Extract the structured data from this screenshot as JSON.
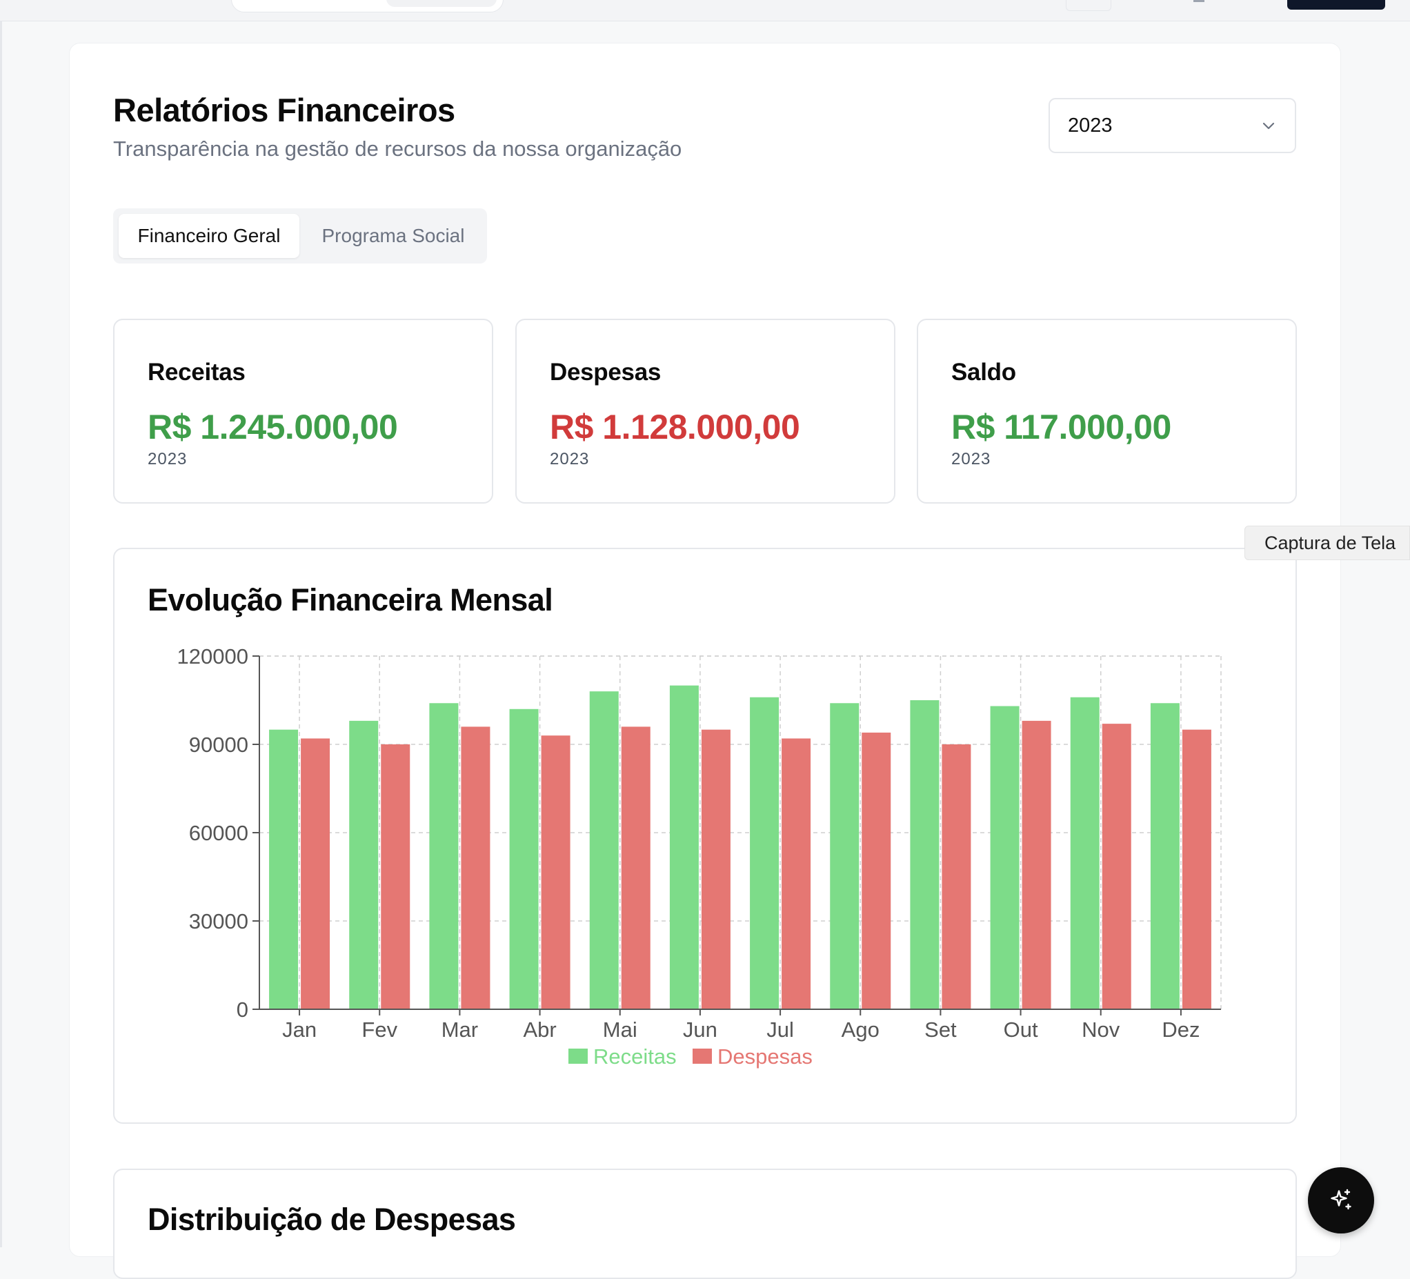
{
  "header": {
    "title": "Relatórios Financeiros",
    "subtitle": "Transparência na gestão de recursos da nossa organização"
  },
  "year_select": {
    "value": "2023",
    "icon": "chevron-down-icon"
  },
  "tabs": [
    {
      "label": "Financeiro Geral",
      "active": true
    },
    {
      "label": "Programa Social",
      "active": false
    }
  ],
  "stats": [
    {
      "label": "Receitas",
      "value": "R$ 1.245.000,00",
      "year": "2023",
      "color": "#3f9e4a"
    },
    {
      "label": "Despesas",
      "value": "R$ 1.128.000,00",
      "year": "2023",
      "color": "#d13b3b"
    },
    {
      "label": "Saldo",
      "value": "R$ 117.000,00",
      "year": "2023",
      "color": "#3f9e4a"
    }
  ],
  "tooltip": {
    "text": "Captura de Tela"
  },
  "chart": {
    "title": "Evolução Financeira Mensal"
  },
  "second_section": {
    "title": "Distribuição de Despesas"
  },
  "fab": {
    "icon": "sparkles-icon"
  },
  "colors": {
    "receitas": "#7ddc89",
    "despesas": "#e57773",
    "accent_green": "#3f9e4a",
    "accent_red": "#d13b3b"
  },
  "chart_data": {
    "type": "bar",
    "title": "Evolução Financeira Mensal",
    "xlabel": "",
    "ylabel": "",
    "categories": [
      "Jan",
      "Fev",
      "Mar",
      "Abr",
      "Mai",
      "Jun",
      "Jul",
      "Ago",
      "Set",
      "Out",
      "Nov",
      "Dez"
    ],
    "series": [
      {
        "name": "Receitas",
        "color": "#7ddc89",
        "values": [
          95000,
          98000,
          104000,
          102000,
          108000,
          110000,
          106000,
          104000,
          105000,
          103000,
          106000,
          104000
        ]
      },
      {
        "name": "Despesas",
        "color": "#e57773",
        "values": [
          92000,
          90000,
          96000,
          93000,
          96000,
          95000,
          92000,
          94000,
          90000,
          98000,
          97000,
          95000
        ]
      }
    ],
    "ylim": [
      0,
      120000
    ],
    "yticks": [
      "0",
      "30000",
      "60000",
      "90000",
      "120000"
    ],
    "grid": true,
    "legend": "bottom-center"
  }
}
